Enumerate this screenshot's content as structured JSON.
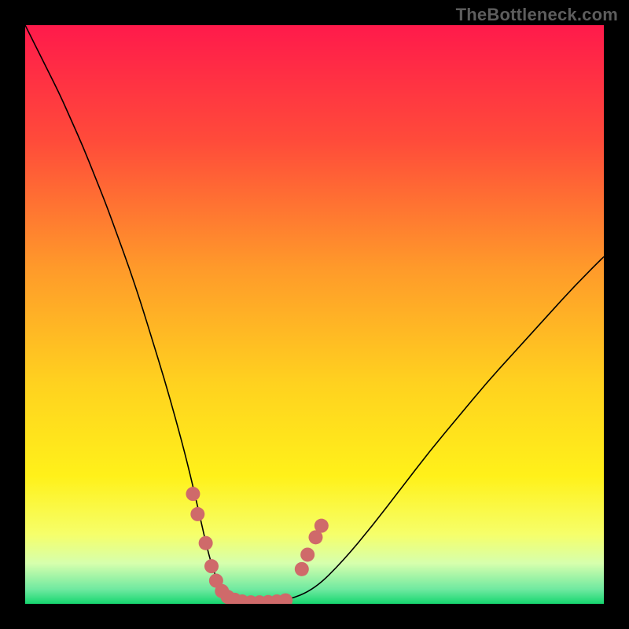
{
  "watermark": {
    "text": "TheBottleneck.com"
  },
  "chart_data": {
    "type": "line",
    "title": "",
    "xlabel": "",
    "ylabel": "",
    "xlim": [
      0,
      100
    ],
    "ylim": [
      0,
      100
    ],
    "grid": false,
    "legend": false,
    "background_gradient": {
      "stops": [
        {
          "offset": 0.0,
          "color": "#ff1a4b"
        },
        {
          "offset": 0.2,
          "color": "#ff4b3a"
        },
        {
          "offset": 0.42,
          "color": "#ff9a2a"
        },
        {
          "offset": 0.62,
          "color": "#ffd21f"
        },
        {
          "offset": 0.78,
          "color": "#fff11a"
        },
        {
          "offset": 0.88,
          "color": "#f6ff6a"
        },
        {
          "offset": 0.93,
          "color": "#d6ffad"
        },
        {
          "offset": 0.975,
          "color": "#6fe9a0"
        },
        {
          "offset": 1.0,
          "color": "#16d66f"
        }
      ]
    },
    "series": [
      {
        "name": "bottleneck-curve",
        "color": "#000000",
        "width": 1.6,
        "x": [
          0,
          2,
          4,
          6,
          8,
          10,
          12,
          14,
          16,
          18,
          20,
          22,
          24,
          26,
          28,
          30,
          31,
          32,
          33,
          34,
          35,
          37,
          40,
          45,
          50,
          55,
          60,
          65,
          70,
          75,
          80,
          85,
          90,
          95,
          100
        ],
        "y": [
          100,
          96,
          92,
          88,
          83.5,
          79,
          74,
          69,
          63.5,
          58,
          52,
          45.5,
          39,
          32,
          24.5,
          16,
          11.5,
          7.5,
          4.5,
          2.5,
          1.3,
          0.5,
          0.2,
          0.5,
          2.5,
          7.5,
          13.5,
          20,
          26.5,
          32.5,
          38.5,
          44,
          49.5,
          55,
          60
        ]
      }
    ],
    "markers": {
      "name": "highlight-dots",
      "color": "#cf6a6a",
      "radius": 9,
      "points": [
        {
          "x": 29.0,
          "y": 19.0
        },
        {
          "x": 29.8,
          "y": 15.5
        },
        {
          "x": 31.2,
          "y": 10.5
        },
        {
          "x": 32.2,
          "y": 6.5
        },
        {
          "x": 33.0,
          "y": 4.0
        },
        {
          "x": 34.0,
          "y": 2.2
        },
        {
          "x": 35.0,
          "y": 1.2
        },
        {
          "x": 36.2,
          "y": 0.7
        },
        {
          "x": 37.5,
          "y": 0.4
        },
        {
          "x": 39.0,
          "y": 0.25
        },
        {
          "x": 40.5,
          "y": 0.25
        },
        {
          "x": 42.0,
          "y": 0.3
        },
        {
          "x": 43.5,
          "y": 0.4
        },
        {
          "x": 45.0,
          "y": 0.6
        },
        {
          "x": 47.8,
          "y": 6.0
        },
        {
          "x": 48.8,
          "y": 8.5
        },
        {
          "x": 50.2,
          "y": 11.5
        },
        {
          "x": 51.2,
          "y": 13.5
        }
      ]
    }
  }
}
